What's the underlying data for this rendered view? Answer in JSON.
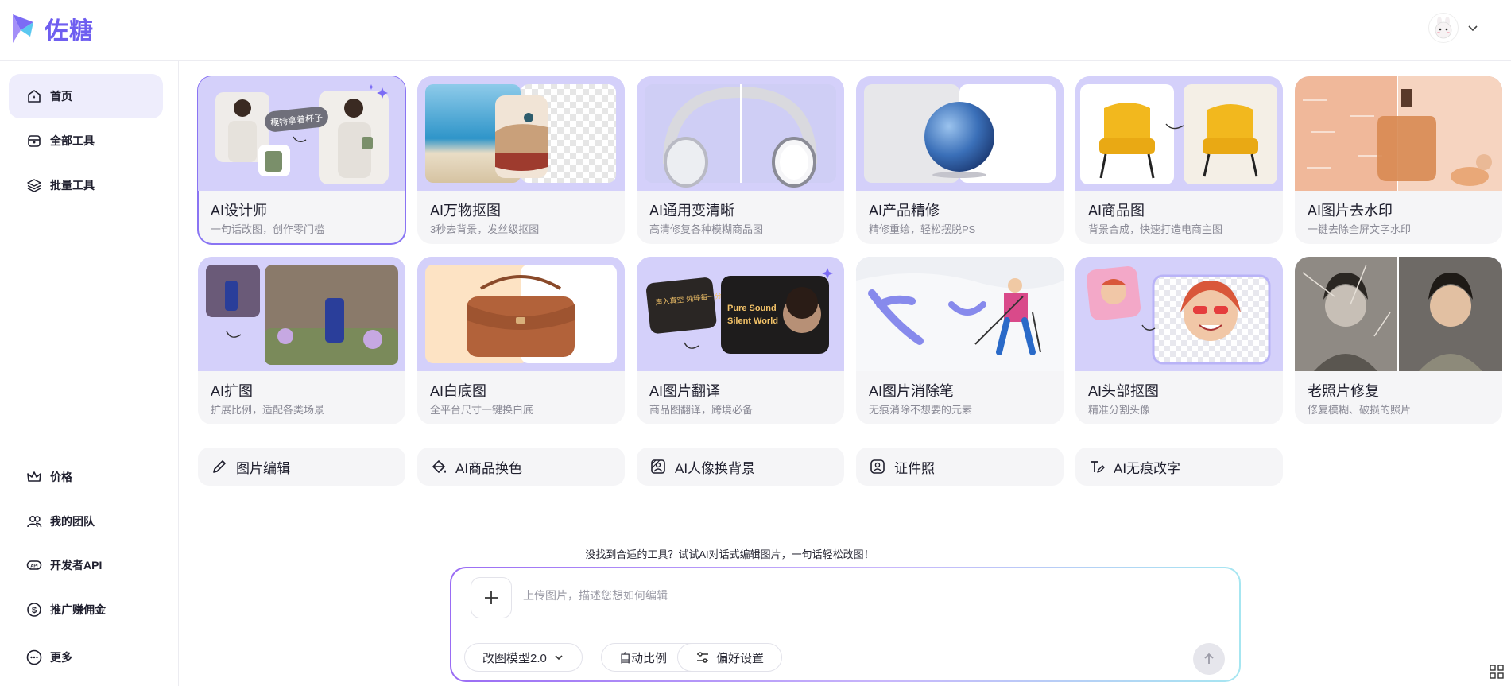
{
  "brand": {
    "name": "佐糖"
  },
  "sidebar": {
    "top_items": [
      {
        "label": "首页",
        "icon": "home-icon",
        "active": true
      },
      {
        "label": "全部工具",
        "icon": "toolbox-icon"
      },
      {
        "label": "批量工具",
        "icon": "layers-icon"
      }
    ],
    "bottom_items": [
      {
        "label": "价格",
        "icon": "crown-icon"
      },
      {
        "label": "我的团队",
        "icon": "team-icon"
      },
      {
        "label": "开发者API",
        "icon": "api-icon"
      },
      {
        "label": "推广赚佣金",
        "icon": "dollar-icon"
      },
      {
        "label": "更多",
        "icon": "more-icon"
      }
    ]
  },
  "cards": [
    {
      "title": "AI设计师",
      "desc": "一句话改图，创作零门槛",
      "img_text": "模特拿着杯子"
    },
    {
      "title": "AI万物抠图",
      "desc": "3秒去背景，发丝级抠图"
    },
    {
      "title": "AI通用变清晰",
      "desc": "高清修复各种模糊商品图"
    },
    {
      "title": "AI产品精修",
      "desc": "精修重绘，轻松摆脱PS"
    },
    {
      "title": "AI商品图",
      "desc": "背景合成，快速打造电商主图"
    },
    {
      "title": "AI图片去水印",
      "desc": "一键去除全屏文字水印"
    },
    {
      "title": "AI扩图",
      "desc": "扩展比例，适配各类场景"
    },
    {
      "title": "AI白底图",
      "desc": "全平台尺寸一键换白底"
    },
    {
      "title": "AI图片翻译",
      "desc": "商品图翻译，跨境必备",
      "img_text": "Pure Sound Silent World",
      "img_text_cn": "声入真空 纯粹每一分贝"
    },
    {
      "title": "AI图片消除笔",
      "desc": "无痕消除不想要的元素"
    },
    {
      "title": "AI头部抠图",
      "desc": "精准分割头像"
    },
    {
      "title": "老照片修复",
      "desc": "修复模糊、破损的照片"
    }
  ],
  "quick_tools": [
    {
      "label": "图片编辑",
      "icon": "pencil-icon"
    },
    {
      "label": "AI商品换色",
      "icon": "paint-bucket-icon"
    },
    {
      "label": "AI人像换背景",
      "icon": "image-swap-icon"
    },
    {
      "label": "证件照",
      "icon": "id-photo-icon"
    },
    {
      "label": "AI无痕改字",
      "icon": "text-edit-icon"
    }
  ],
  "prompt": {
    "hint": "没找到合适的工具？试试AI对话式编辑图片，一句话轻松改图！",
    "placeholder": "上传图片，描述您想如何编辑",
    "model_label": "改图模型2.0",
    "ratio_label": "自动比例",
    "settings_label": "偏好设置"
  },
  "colors": {
    "accent": "#6f5ef0",
    "active_bg": "#eeedfc",
    "card_bg": "#f5f5f7",
    "thumb_bg": "#d9d7fb"
  }
}
